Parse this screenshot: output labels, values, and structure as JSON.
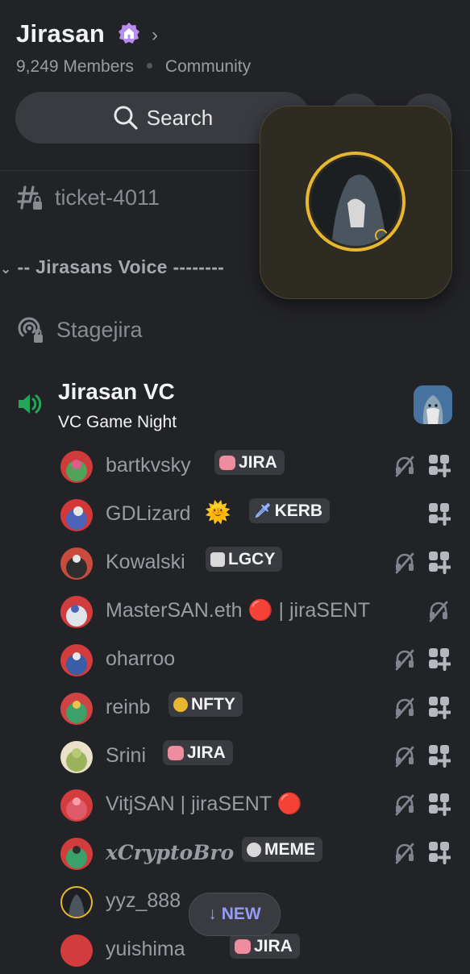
{
  "server": {
    "name": "Jirasan",
    "members": "9,249 Members",
    "type": "Community"
  },
  "search": {
    "label": "Search"
  },
  "channels": {
    "ticket": "ticket-4011",
    "category": "-- Jirasans Voice --------",
    "stage": "Stagejira"
  },
  "voice": {
    "name": "Jirasan VC",
    "status": "VC Game Night",
    "users": [
      {
        "name": "bartkvsky",
        "tag": "JIRA",
        "tag_emoji": "pink-hand",
        "deafened": true
      },
      {
        "name": "GDLizard",
        "emoji": "🌞",
        "tag": "KERB",
        "tag_emoji": "sword",
        "deafened": false
      },
      {
        "name": "Kowalski",
        "tag": "LGCY",
        "tag_emoji": "scroll",
        "deafened": true
      },
      {
        "name": "MasterSAN.eth 🔴 | jiraSENT",
        "deafened": true,
        "activity": false
      },
      {
        "name": "oharroo",
        "deafened": true
      },
      {
        "name": "reinb",
        "tag": "NFTY",
        "tag_emoji": "skull-gold",
        "deafened": true
      },
      {
        "name": "Srini",
        "tag": "JIRA",
        "tag_emoji": "pink-hand",
        "deafened": true
      },
      {
        "name": "VitjSAN | jiraSENT 🔴",
        "deafened": true
      },
      {
        "name": "xCryptoBro",
        "tag": "MEME",
        "tag_emoji": "skull",
        "deafened": true
      },
      {
        "name": "yyz_888"
      },
      {
        "name": "yuishima",
        "tag": "JIRA"
      }
    ]
  },
  "new_pill": {
    "label": "NEW",
    "arrow": "↓"
  },
  "colors": {
    "background": "#222327",
    "accent_blurple": "#949cf7",
    "speaker_green": "#23a55a",
    "live_red": "#da373c"
  }
}
